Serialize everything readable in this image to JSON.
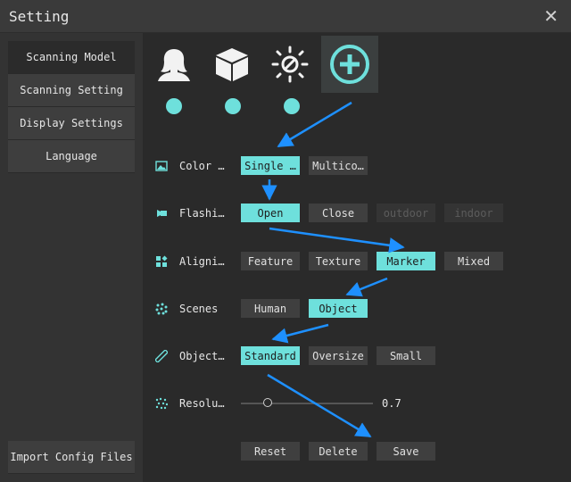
{
  "window": {
    "title": "Setting",
    "close_glyph": "✕"
  },
  "sidebar": {
    "items": [
      {
        "label": "Scanning Model",
        "active": true
      },
      {
        "label": "Scanning Setting",
        "active": false
      },
      {
        "label": "Display Settings",
        "active": false
      },
      {
        "label": "Language",
        "active": false
      }
    ],
    "import_label": "Import Config Files"
  },
  "modes": [
    {
      "icon": "person-icon",
      "active": false
    },
    {
      "icon": "box-icon",
      "active": false
    },
    {
      "icon": "sun-icon",
      "active": false
    },
    {
      "icon": "plus-circle-icon",
      "active": true
    }
  ],
  "rows": {
    "color": {
      "label": "Color …",
      "options": [
        "Single …",
        "Multico…"
      ],
      "selected": "Single …"
    },
    "flash": {
      "label": "Flashi…",
      "options": [
        "Open",
        "Close",
        "outdoor",
        "indoor"
      ],
      "selected": "Open",
      "disabled": [
        "outdoor",
        "indoor"
      ]
    },
    "align": {
      "label": "Aligni…",
      "options": [
        "Feature",
        "Texture",
        "Marker",
        "Mixed"
      ],
      "selected": "Marker"
    },
    "scenes": {
      "label": "Scenes",
      "options": [
        "Human",
        "Object"
      ],
      "selected": "Object"
    },
    "object": {
      "label": "Object…",
      "options": [
        "Standard",
        "Oversize",
        "Small"
      ],
      "selected": "Standard"
    },
    "resolution": {
      "label": "Resolu…",
      "value": "0.7",
      "position": 0.2
    }
  },
  "actions": {
    "reset": "Reset",
    "delete": "Delete",
    "save": "Save"
  },
  "colors": {
    "accent": "#6ee0dc",
    "arrow": "#1e90ff"
  }
}
